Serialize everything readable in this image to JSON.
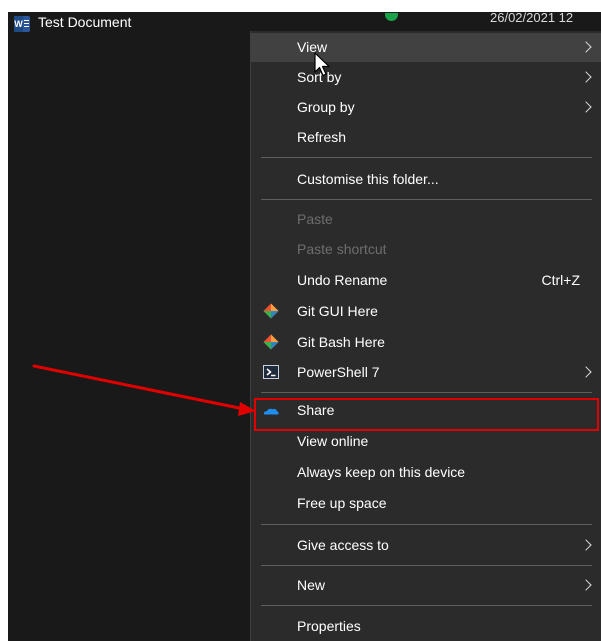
{
  "file": {
    "name": "Test Document",
    "date": "26/02/2021 12"
  },
  "menu": {
    "items": [
      {
        "label": "View",
        "submenu": true,
        "hover": true
      },
      {
        "label": "Sort by",
        "submenu": true
      },
      {
        "label": "Group by",
        "submenu": true
      },
      {
        "label": "Refresh"
      },
      {
        "label": "Customise this folder..."
      },
      {
        "label": "Paste",
        "disabled": true
      },
      {
        "label": "Paste shortcut",
        "disabled": true
      },
      {
        "label": "Undo Rename",
        "shortcut": "Ctrl+Z"
      },
      {
        "label": "Git GUI Here",
        "icon": "git-icon"
      },
      {
        "label": "Git Bash Here",
        "icon": "git-icon"
      },
      {
        "label": "PowerShell 7",
        "icon": "powershell-icon",
        "submenu": true
      },
      {
        "label": "Share",
        "icon": "onedrive-cloud-icon"
      },
      {
        "label": "View online"
      },
      {
        "label": "Always keep on this device"
      },
      {
        "label": "Free up space"
      },
      {
        "label": "Give access to",
        "submenu": true
      },
      {
        "label": "New",
        "submenu": true
      },
      {
        "label": "Properties"
      }
    ]
  },
  "colors": {
    "menu_background": "#2b2b2b",
    "hover_background": "#414141",
    "annotation_red": "#e00000",
    "disabled_text": "#6d6d6d",
    "onedrive_blue": "#1e8ff0"
  }
}
